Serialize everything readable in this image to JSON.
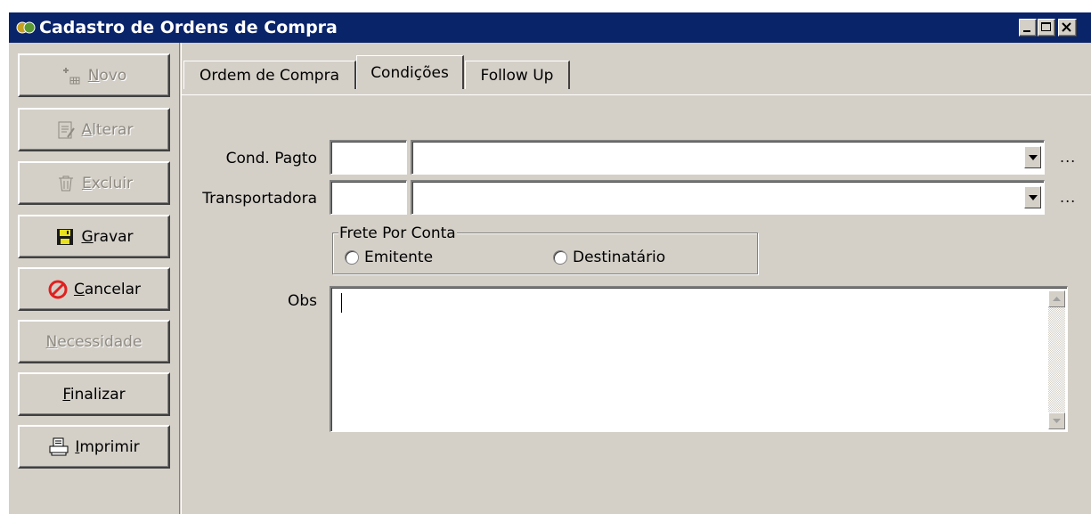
{
  "window": {
    "title": "Cadastro de Ordens de Compra",
    "controls": [
      "minimize-icon",
      "maximize-icon",
      "close-icon"
    ]
  },
  "sidebar": {
    "buttons": [
      {
        "label": "Novo",
        "icon": "new-record-icon",
        "enabled": false
      },
      {
        "label": "Alterar",
        "icon": "edit-record-icon",
        "enabled": false
      },
      {
        "label": "Excluir",
        "icon": "trash-icon",
        "enabled": false
      },
      {
        "label": "Gravar",
        "icon": "save-disk-icon",
        "enabled": true
      },
      {
        "label": "Cancelar",
        "icon": "cancel-icon",
        "enabled": true
      },
      {
        "label": "Necessidade",
        "icon": "",
        "enabled": false
      },
      {
        "label": "Finalizar",
        "icon": "",
        "enabled": true
      },
      {
        "label": "Imprimir",
        "icon": "printer-icon",
        "enabled": true
      }
    ]
  },
  "tabs": [
    {
      "label": "Ordem de Compra",
      "active": false
    },
    {
      "label": "Condições",
      "active": true
    },
    {
      "label": "Follow Up",
      "active": false
    }
  ],
  "form": {
    "cond_pagto": {
      "label": "Cond. Pagto",
      "code": "",
      "description": "",
      "lookup": "..."
    },
    "transportadora": {
      "label": "Transportadora",
      "code": "",
      "description": "",
      "lookup": "..."
    },
    "frete": {
      "label": "Frete Por Conta",
      "options": [
        {
          "label": "Emitente",
          "selected": false
        },
        {
          "label": "Destinatário",
          "selected": false
        }
      ]
    },
    "obs": {
      "label": "Obs",
      "value": ""
    }
  },
  "colors": {
    "titlebar": "#0a246a",
    "face": "#d4d0c8",
    "disabled_text": "#8e8a82",
    "cancel_red": "#e02020"
  }
}
